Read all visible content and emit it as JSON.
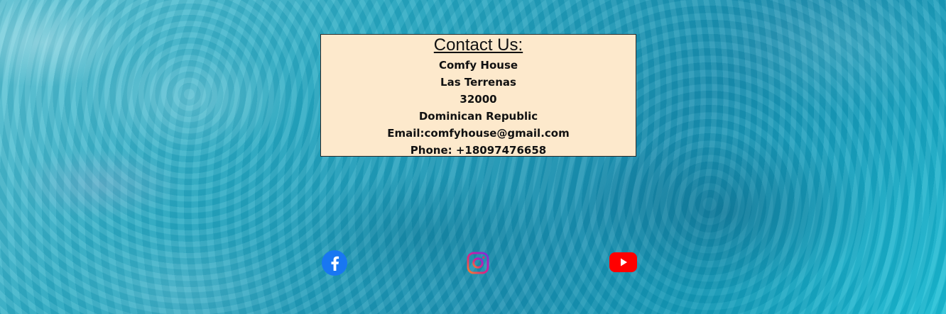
{
  "contact": {
    "title": "Contact Us:",
    "lines": [
      "Comfy House",
      "Las Terrenas",
      "32000",
      "Dominican Republic",
      "Email:comfyhouse@gmail.com",
      "Phone: +18097476658"
    ]
  },
  "social": {
    "icons": [
      {
        "icon": "facebook-icon",
        "color": "#1877f2"
      },
      {
        "icon": "instagram-icon",
        "color": "#e1306c"
      },
      {
        "icon": "youtube-icon",
        "color": "#ff0000"
      }
    ]
  },
  "colors": {
    "panel_background": "#fde9cc",
    "panel_border": "#2a2a2a",
    "water_accent": "#28aac3"
  }
}
